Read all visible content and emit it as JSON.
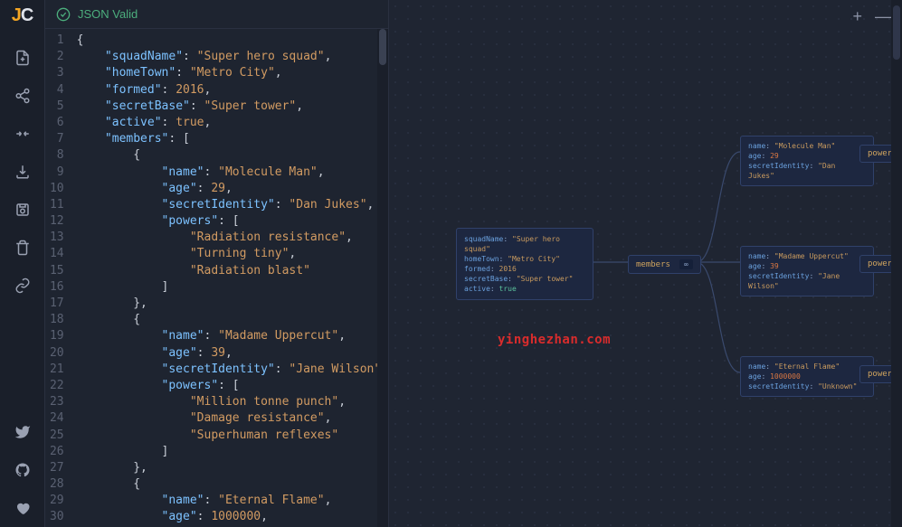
{
  "logo": {
    "j": "J",
    "c": "C"
  },
  "status": {
    "label": "JSON Valid"
  },
  "sidebar_icons": [
    "new-file-icon",
    "share-icon",
    "collapse-icon",
    "download-icon",
    "save-icon",
    "delete-icon",
    "link-icon",
    "twitter-icon",
    "github-icon",
    "heart-icon"
  ],
  "code": {
    "lines": [
      {
        "n": 1,
        "i": 0,
        "t": "punc",
        "v": "{"
      },
      {
        "n": 2,
        "i": 1,
        "t": "kv_s",
        "k": "squadName",
        "v": "Super hero squad",
        "c": true
      },
      {
        "n": 3,
        "i": 1,
        "t": "kv_s",
        "k": "homeTown",
        "v": "Metro City",
        "c": true
      },
      {
        "n": 4,
        "i": 1,
        "t": "kv_n",
        "k": "formed",
        "v": "2016",
        "c": true
      },
      {
        "n": 5,
        "i": 1,
        "t": "kv_s",
        "k": "secretBase",
        "v": "Super tower",
        "c": true
      },
      {
        "n": 6,
        "i": 1,
        "t": "kv_b",
        "k": "active",
        "v": "true",
        "c": true
      },
      {
        "n": 7,
        "i": 1,
        "t": "kv_o",
        "k": "members",
        "v": "["
      },
      {
        "n": 8,
        "i": 2,
        "t": "punc",
        "v": "{"
      },
      {
        "n": 9,
        "i": 3,
        "t": "kv_s",
        "k": "name",
        "v": "Molecule Man",
        "c": true
      },
      {
        "n": 10,
        "i": 3,
        "t": "kv_n",
        "k": "age",
        "v": "29",
        "c": true
      },
      {
        "n": 11,
        "i": 3,
        "t": "kv_s",
        "k": "secretIdentity",
        "v": "Dan Jukes",
        "c": true
      },
      {
        "n": 12,
        "i": 3,
        "t": "kv_o",
        "k": "powers",
        "v": "["
      },
      {
        "n": 13,
        "i": 4,
        "t": "str",
        "v": "Radiation resistance",
        "c": true
      },
      {
        "n": 14,
        "i": 4,
        "t": "str",
        "v": "Turning tiny",
        "c": true
      },
      {
        "n": 15,
        "i": 4,
        "t": "str",
        "v": "Radiation blast"
      },
      {
        "n": 16,
        "i": 3,
        "t": "punc",
        "v": "]"
      },
      {
        "n": 17,
        "i": 2,
        "t": "punc",
        "v": "},"
      },
      {
        "n": 18,
        "i": 2,
        "t": "punc",
        "v": "{"
      },
      {
        "n": 19,
        "i": 3,
        "t": "kv_s",
        "k": "name",
        "v": "Madame Uppercut",
        "c": true
      },
      {
        "n": 20,
        "i": 3,
        "t": "kv_n",
        "k": "age",
        "v": "39",
        "c": true
      },
      {
        "n": 21,
        "i": 3,
        "t": "kv_s",
        "k": "secretIdentity",
        "v": "Jane Wilson",
        "c": true
      },
      {
        "n": 22,
        "i": 3,
        "t": "kv_o",
        "k": "powers",
        "v": "["
      },
      {
        "n": 23,
        "i": 4,
        "t": "str",
        "v": "Million tonne punch",
        "c": true
      },
      {
        "n": 24,
        "i": 4,
        "t": "str",
        "v": "Damage resistance",
        "c": true
      },
      {
        "n": 25,
        "i": 4,
        "t": "str",
        "v": "Superhuman reflexes"
      },
      {
        "n": 26,
        "i": 3,
        "t": "punc",
        "v": "]"
      },
      {
        "n": 27,
        "i": 2,
        "t": "punc",
        "v": "},"
      },
      {
        "n": 28,
        "i": 2,
        "t": "punc",
        "v": "{"
      },
      {
        "n": 29,
        "i": 3,
        "t": "kv_s",
        "k": "name",
        "v": "Eternal Flame",
        "c": true
      },
      {
        "n": 30,
        "i": 3,
        "t": "kv_n",
        "k": "age",
        "v": "1000000",
        "c": true
      }
    ]
  },
  "graph": {
    "root": [
      {
        "k": "squadName",
        "v": "\"Super hero squad\"",
        "t": "s"
      },
      {
        "k": "homeTown",
        "v": "\"Metro City\"",
        "t": "s"
      },
      {
        "k": "formed",
        "v": "2016",
        "t": "n"
      },
      {
        "k": "secretBase",
        "v": "\"Super tower\"",
        "t": "s"
      },
      {
        "k": "active",
        "v": "true",
        "t": "b"
      }
    ],
    "members_label": "members",
    "members_count": "∞",
    "members": [
      [
        {
          "k": "name",
          "v": "\"Molecule Man\"",
          "t": "s"
        },
        {
          "k": "age",
          "v": "29",
          "t": "n"
        },
        {
          "k": "secretIdentity",
          "v": "\"Dan Jukes\"",
          "t": "s"
        }
      ],
      [
        {
          "k": "name",
          "v": "\"Madame Uppercut\"",
          "t": "s"
        },
        {
          "k": "age",
          "v": "39",
          "t": "n"
        },
        {
          "k": "secretIdentity",
          "v": "\"Jane Wilson\"",
          "t": "s"
        }
      ],
      [
        {
          "k": "name",
          "v": "\"Eternal Flame\"",
          "t": "s"
        },
        {
          "k": "age",
          "v": "1000000",
          "t": "n"
        },
        {
          "k": "secretIdentity",
          "v": "\"Unknown\"",
          "t": "s"
        }
      ]
    ],
    "powers_label": "power"
  },
  "watermark": "yinghezhan.com",
  "toolbar": {
    "add": "+",
    "remove": "—"
  }
}
